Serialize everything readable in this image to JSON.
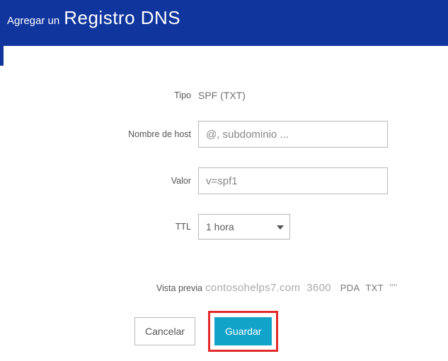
{
  "header": {
    "pre": "Agregar un",
    "title": "Registro DNS"
  },
  "form": {
    "type_label": "Tipo",
    "type_value": "SPF (TXT)",
    "host_label": "Nombre de host",
    "host_placeholder": "@, subdominio ...",
    "value_label": "Valor",
    "value_placeholder": "v=spf1",
    "ttl_label": "TTL",
    "ttl_value": "1 hora"
  },
  "preview": {
    "label": "Vista previa",
    "domain": "contosohelps7.com",
    "ttl": "3600",
    "tag1": "PDA",
    "tag2": "TXT",
    "quotes": "\"\""
  },
  "buttons": {
    "cancel": "Cancelar",
    "save": "Guardar"
  }
}
